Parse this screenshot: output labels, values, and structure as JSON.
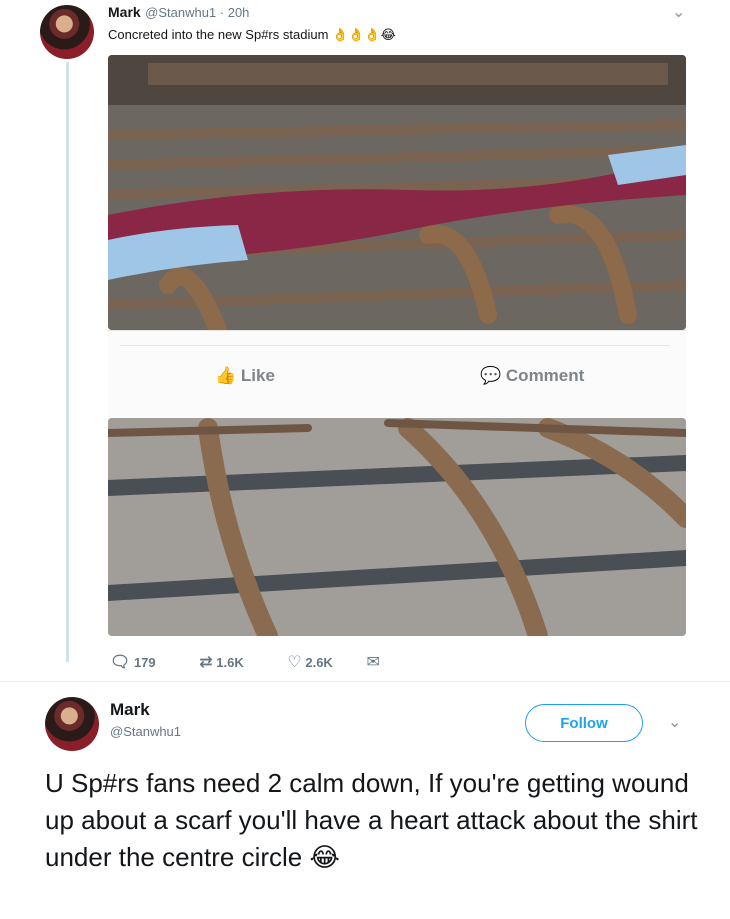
{
  "retweeted": {
    "name": "Mark",
    "handle_time": "@Stanwhu1 · 20h",
    "text": "Concreted into the new Sp#rs stadium",
    "text_emojis": [
      "👌",
      "👌",
      "👌",
      "😂"
    ],
    "fb_like_label": "Like",
    "fb_comment_label": "Comment",
    "counts": {
      "replies": "179",
      "retweets": "1.6K",
      "likes": "2.6K"
    }
  },
  "tweet": {
    "name": "Mark",
    "handle": "@Stanwhu1",
    "follow_label": "Follow",
    "text": "U Sp#rs fans need 2 calm down, If you're getting wound up about a scarf you'll have a heart attack about the shirt under the centre circle",
    "text_emoji": "😂"
  },
  "colors": {
    "accent": "#1da1f2",
    "scarf_claret": "#8a2746",
    "scarf_blue": "#9fc6e6"
  },
  "icons": {
    "reply": "reply-icon",
    "retweet": "retweet-icon",
    "like": "heart-icon",
    "dm": "envelope-icon",
    "chevron": "chevron-down-icon"
  }
}
